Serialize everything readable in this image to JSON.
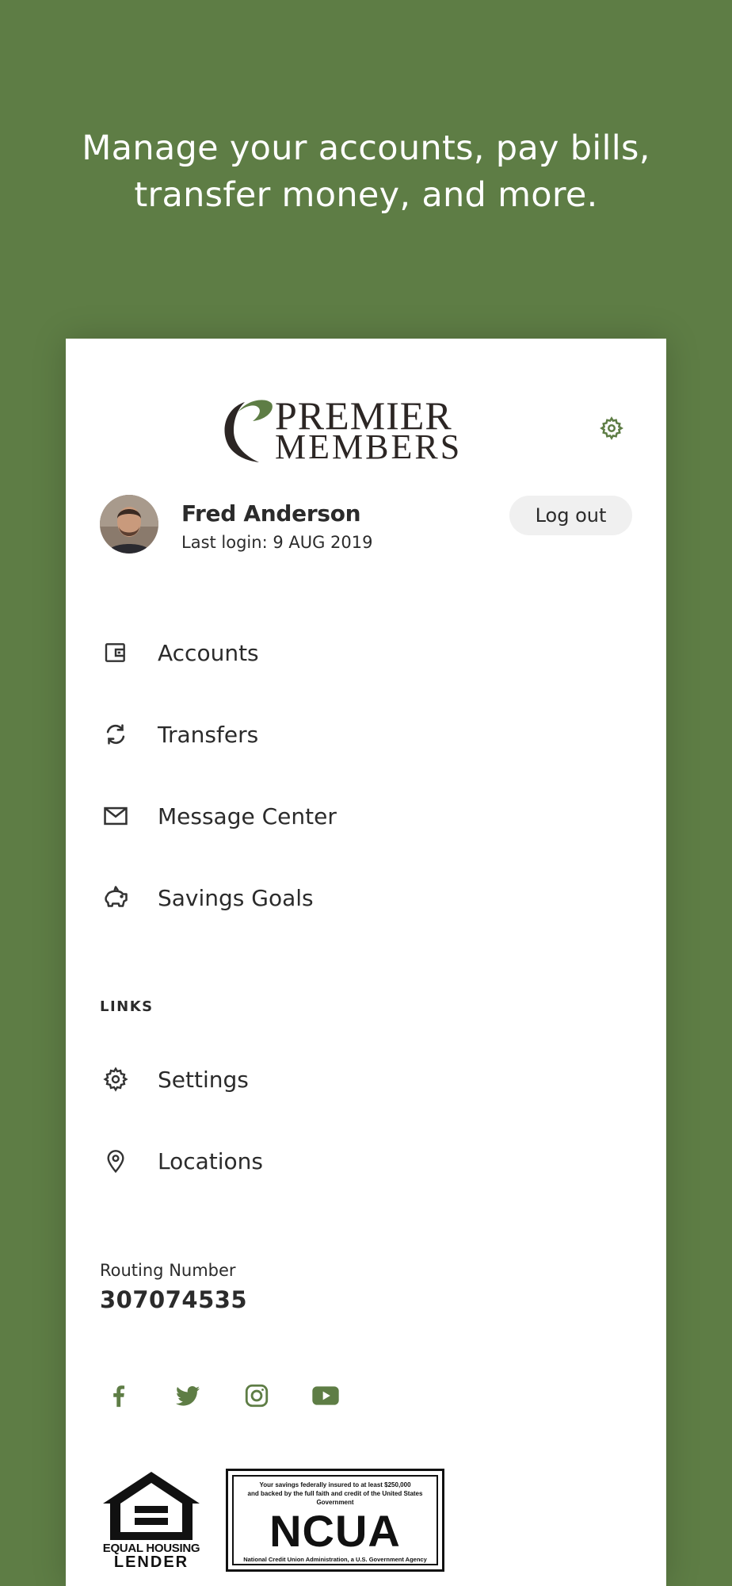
{
  "hero": {
    "line1": "Manage your accounts, pay bills,",
    "line2": "transfer money, and more."
  },
  "brand": {
    "line1": "PREMIER",
    "line2": "MEMBERS",
    "accent_color": "#5e7d45"
  },
  "header": {
    "settings_icon": "gear-icon"
  },
  "user": {
    "name": "Fred Anderson",
    "last_login": "Last login: 9 AUG 2019",
    "logout_label": "Log out"
  },
  "menu": {
    "items": [
      {
        "label": "Accounts",
        "icon": "wallet-icon"
      },
      {
        "label": "Transfers",
        "icon": "sync-icon"
      },
      {
        "label": "Message Center",
        "icon": "envelope-icon"
      },
      {
        "label": "Savings Goals",
        "icon": "piggy-bank-icon"
      }
    ]
  },
  "links": {
    "header": "LINKS",
    "items": [
      {
        "label": "Settings",
        "icon": "gear-icon"
      },
      {
        "label": "Locations",
        "icon": "location-pin-icon"
      }
    ]
  },
  "routing": {
    "label": "Routing Number",
    "value": "307074535"
  },
  "social": [
    "facebook-icon",
    "twitter-icon",
    "instagram-icon",
    "youtube-icon"
  ],
  "badges": {
    "eho_line1": "EQUAL HOUSING",
    "eho_line2": "LENDER",
    "ncua_top1": "Your savings federally insured to at least $250,000",
    "ncua_top2": "and backed by the full faith and credit of the United States Government",
    "ncua_name": "NCUA",
    "ncua_bottom": "National Credit Union Administration, a U.S. Government Agency"
  }
}
